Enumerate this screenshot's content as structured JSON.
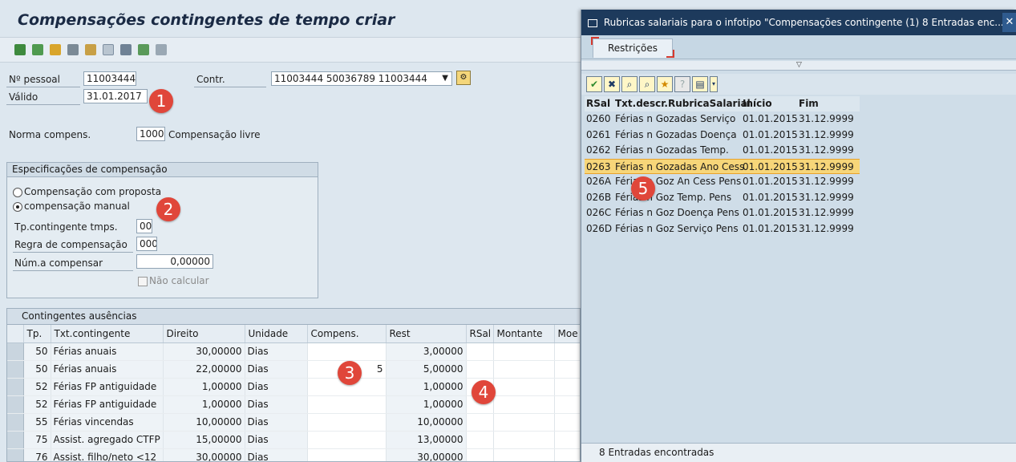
{
  "screen": {
    "title": "Compensações contingentes de tempo criar",
    "personnel_label": "Nº pessoal",
    "personnel_value": "11003444",
    "contract_label": "Contr.",
    "contract_value": "11003444 50036789 11003444",
    "valid_label": "Válido",
    "valid_value": "31.01.2017",
    "norm_label": "Norma compens.",
    "norm_code": "1000",
    "norm_text": "Compensação livre"
  },
  "spec_group": {
    "title": "Especificações de compensação",
    "radio_proposal": "Compensação com proposta",
    "radio_manual": "compensação manual",
    "quota_type_label": "Tp.contingente tmps.",
    "quota_type_value": "00",
    "rule_label": "Regra de compensação",
    "rule_value": "000",
    "amount_label": "Núm.a compensar",
    "amount_value": "0,00000",
    "no_calc_label": "Não calcular"
  },
  "quota_table": {
    "title": "Contingentes ausências",
    "columns": [
      "Tp.",
      "Txt.contingente",
      "Direito",
      "Unidade",
      "Compens.",
      "Rest",
      "RSal",
      "Montante",
      "Moe"
    ],
    "rows": [
      {
        "tp": "50",
        "txt": "Férias anuais",
        "direito": "30,00000",
        "unidade": "Dias",
        "compens": "",
        "rest": "3,00000"
      },
      {
        "tp": "50",
        "txt": "Férias anuais",
        "direito": "22,00000",
        "unidade": "Dias",
        "compens": "5",
        "rest": "5,00000"
      },
      {
        "tp": "52",
        "txt": "Férias FP antiguidade",
        "direito": "1,00000",
        "unidade": "Dias",
        "compens": "",
        "rest": "1,00000"
      },
      {
        "tp": "52",
        "txt": "Férias FP antiguidade",
        "direito": "1,00000",
        "unidade": "Dias",
        "compens": "",
        "rest": "1,00000"
      },
      {
        "tp": "55",
        "txt": "Férias vincendas",
        "direito": "10,00000",
        "unidade": "Dias",
        "compens": "",
        "rest": "10,00000"
      },
      {
        "tp": "75",
        "txt": "Assist. agregado CTFP",
        "direito": "15,00000",
        "unidade": "Dias",
        "compens": "",
        "rest": "13,00000"
      },
      {
        "tp": "76",
        "txt": "Assist. filho/neto <12",
        "direito": "30,00000",
        "unidade": "Dias",
        "compens": "",
        "rest": "30,00000"
      }
    ]
  },
  "badges": [
    "1",
    "2",
    "3",
    "4",
    "5"
  ],
  "popup": {
    "title": "Rubricas salariais para o infotipo \"Compensações contingente (1)   8 Entradas enc...",
    "close_label": "✕",
    "tab_label": "Restrições",
    "columns": [
      "RSal",
      "Txt.descr.RubricaSalarial",
      "Início",
      "Fim"
    ],
    "rows": [
      {
        "code": "0260",
        "text": "Férias n Gozadas Serviço",
        "start": "01.01.2015",
        "end": "31.12.9999"
      },
      {
        "code": "0261",
        "text": "Férias n Gozadas Doença",
        "start": "01.01.2015",
        "end": "31.12.9999"
      },
      {
        "code": "0262",
        "text": "Férias n Gozadas Temp.",
        "start": "01.01.2015",
        "end": "31.12.9999"
      },
      {
        "code": "0263",
        "text": "Férias n Gozadas Ano Cess",
        "start": "01.01.2015",
        "end": "31.12.9999"
      },
      {
        "code": "026A",
        "text": "Férias n Goz An Cess Pens",
        "start": "01.01.2015",
        "end": "31.12.9999"
      },
      {
        "code": "026B",
        "text": "Férias n Goz Temp. Pens",
        "start": "01.01.2015",
        "end": "31.12.9999"
      },
      {
        "code": "026C",
        "text": "Férias n Goz Doença Pens",
        "start": "01.01.2015",
        "end": "31.12.9999"
      },
      {
        "code": "026D",
        "text": "Férias n Goz Serviço Pens",
        "start": "01.01.2015",
        "end": "31.12.9999"
      }
    ],
    "highlighted_row": 3,
    "status": "8 Entradas encontradas"
  },
  "colors": {
    "badge": "#e0463a",
    "highlight_row": "#f7d679",
    "popup_title": "#1d3a5c"
  }
}
